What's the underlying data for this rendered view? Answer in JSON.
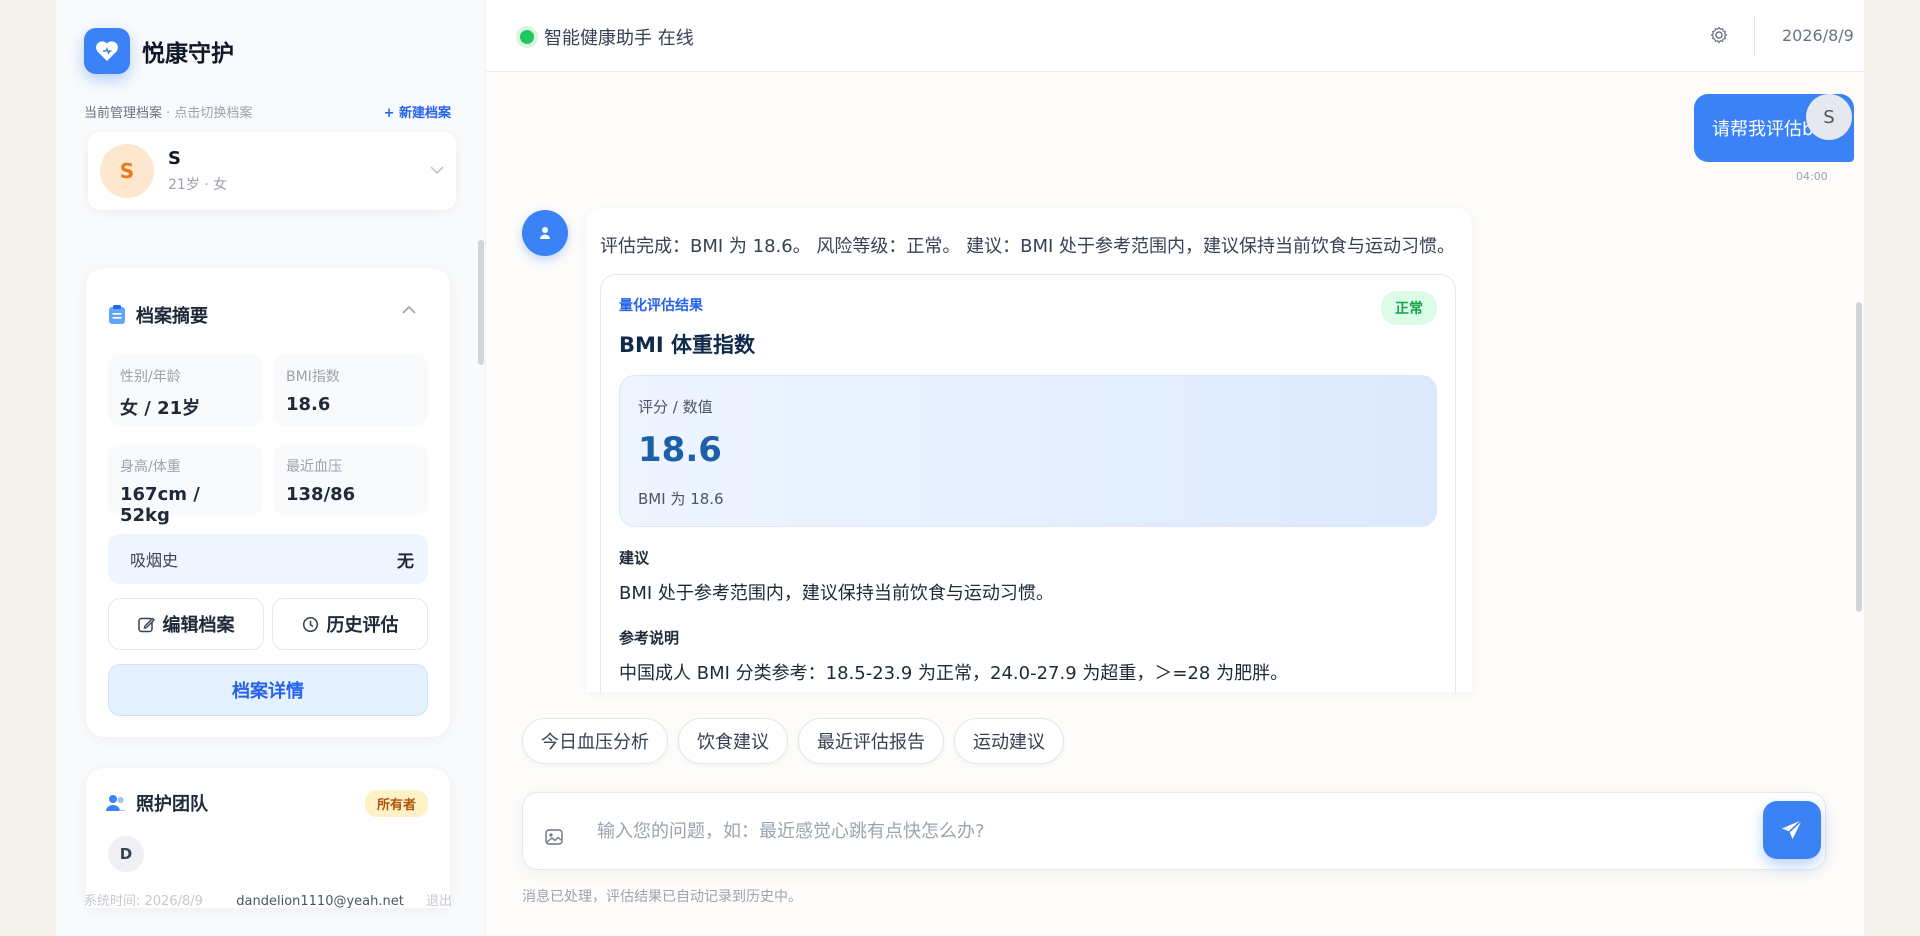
{
  "brand": {
    "name": "悦康守护",
    "logo_icon": "heart-icon",
    "accent": "#3b82f6"
  },
  "profile": {
    "header_label": "当前管理档案",
    "header_hint": " · 点击切换档案",
    "new_profile": "+ 新建档案",
    "avatar_letter": "S",
    "name": "S",
    "meta": "21岁 · 女"
  },
  "summary": {
    "title": "档案摘要",
    "stats": [
      {
        "label": "性别/年龄",
        "value": "女 / 21岁"
      },
      {
        "label": "BMI指数",
        "value": "18.6"
      },
      {
        "label": "身高/体重",
        "value": "167cm / 52kg"
      },
      {
        "label": "最近血压",
        "value": "138/86"
      }
    ],
    "smoking_label": "吸烟史",
    "smoking_value": "无",
    "edit_button": "编辑档案",
    "history_button": "历史评估",
    "detail_button": "档案详情"
  },
  "team": {
    "title": "照护团队",
    "owner_badge": "所有者",
    "member_letter": "D"
  },
  "sidebar_footer": {
    "system_time": "系统时间: 2026/8/9",
    "email": "dandelion1110@yeah.net",
    "logout": "退出"
  },
  "topbar": {
    "status": "智能健康助手 在线",
    "status_color": "#22c55e",
    "date": "2026/8/9"
  },
  "chat": {
    "user_message": "请帮我评估bmi",
    "user_avatar": "S",
    "user_time": "04:00",
    "bot_text": "评估完成：BMI 为 18.6。 风险等级：正常。 建议：BMI 处于参考范围内，建议保持当前饮食与运动习惯。",
    "result": {
      "tag": "量化评估结果",
      "badge": "正常",
      "badge_color": "#16a34a",
      "title": "BMI 体重指数",
      "score_label": "评分 / 数值",
      "score_value": "18.6",
      "score_note": "BMI 为 18.6",
      "advice_heading": "建议",
      "advice_text": "BMI 处于参考范围内，建议保持当前饮食与运动习惯。",
      "ref_heading": "参考说明",
      "ref_text": "中国成人 BMI 分类参考：18.5-23.9 为正常，24.0-27.9 为超重，＞=28 为肥胖。"
    }
  },
  "quick_actions": [
    "今日血压分析",
    "饮食建议",
    "最近评估报告",
    "运动建议"
  ],
  "composer": {
    "placeholder": "输入您的问题，如：最近感觉心跳有点快怎么办?",
    "footnote": "消息已处理，评估结果已自动记录到历史中。"
  }
}
